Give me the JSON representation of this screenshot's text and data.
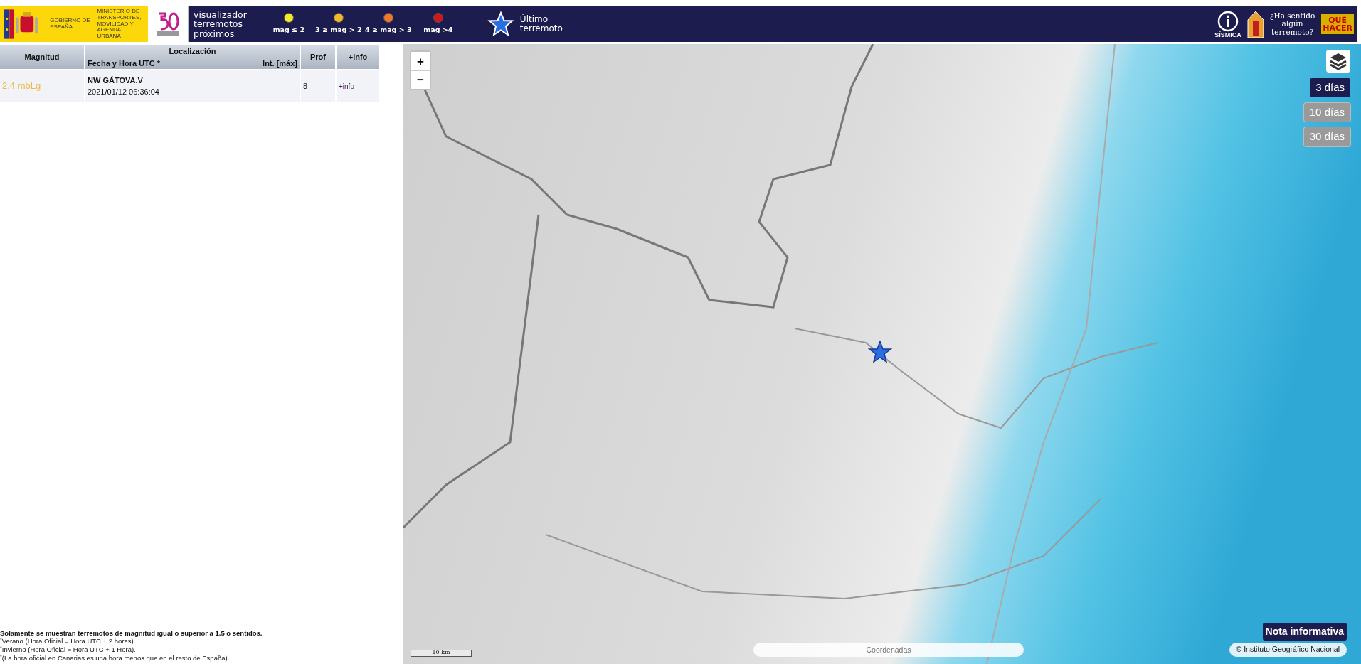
{
  "header": {
    "gov_logo": {
      "gobierno": "GOBIERNO DE ESPAÑA",
      "ministerio": "MINISTERIO DE TRANSPORTES, MOVILIDAD Y AGENDA URBANA"
    },
    "legend_title": [
      "visualizador",
      "terremotos",
      "próximos"
    ],
    "legend": [
      {
        "label": "mag ≤ 2",
        "color": "#f5e92a"
      },
      {
        "label": "3 ≥ mag > 2",
        "color": "#f5b82a"
      },
      {
        "label": "4 ≥ mag > 3",
        "color": "#f0782a"
      },
      {
        "label": "mag >4",
        "color": "#d01818"
      }
    ],
    "last_quake": [
      "Último",
      "terremoto"
    ],
    "sismica": "SÍSMICA",
    "felt": [
      "¿Ha sentido",
      "algún",
      "terremoto?"
    ],
    "que_hacer": [
      "QUÉ",
      "HACER"
    ]
  },
  "table": {
    "columns": {
      "magnitude": "Magnitud",
      "location": "Localización",
      "datetime": "Fecha y Hora UTC *",
      "intensity": "Int. [máx]",
      "depth": "Prof",
      "info": "+info"
    },
    "rows": [
      {
        "magnitude": "2.4 mbLg",
        "color": "#f0b840",
        "location": "NW GÁTOVA.V",
        "datetime": "2021/01/12 06:36:04",
        "depth": "8",
        "info": "+info"
      }
    ]
  },
  "footnotes": {
    "note": "Solamente se muestran terremotos de magnitud igual o superior a 1.5 o sentidos.",
    "lines": [
      "$^{*}$Verano (Hora Oficial = Hora UTC + 2 horas).",
      "$^{*}$Invierno (Hora Oficial = Hora UTC + 1 Hora).",
      "$^{*}$(La hora oficial en Canarias es una hora menos que en el resto de España)"
    ]
  },
  "map": {
    "zoom_in": "+",
    "zoom_out": "−",
    "ranges": [
      {
        "label": "3 días",
        "selected": true
      },
      {
        "label": "10 días",
        "selected": false
      },
      {
        "label": "30 días",
        "selected": false
      }
    ],
    "note_button": "Nota informativa",
    "coords_placeholder": "Coordenadas",
    "scale": "10 km",
    "attribution": "© Instituto Geográfico Nacional"
  }
}
